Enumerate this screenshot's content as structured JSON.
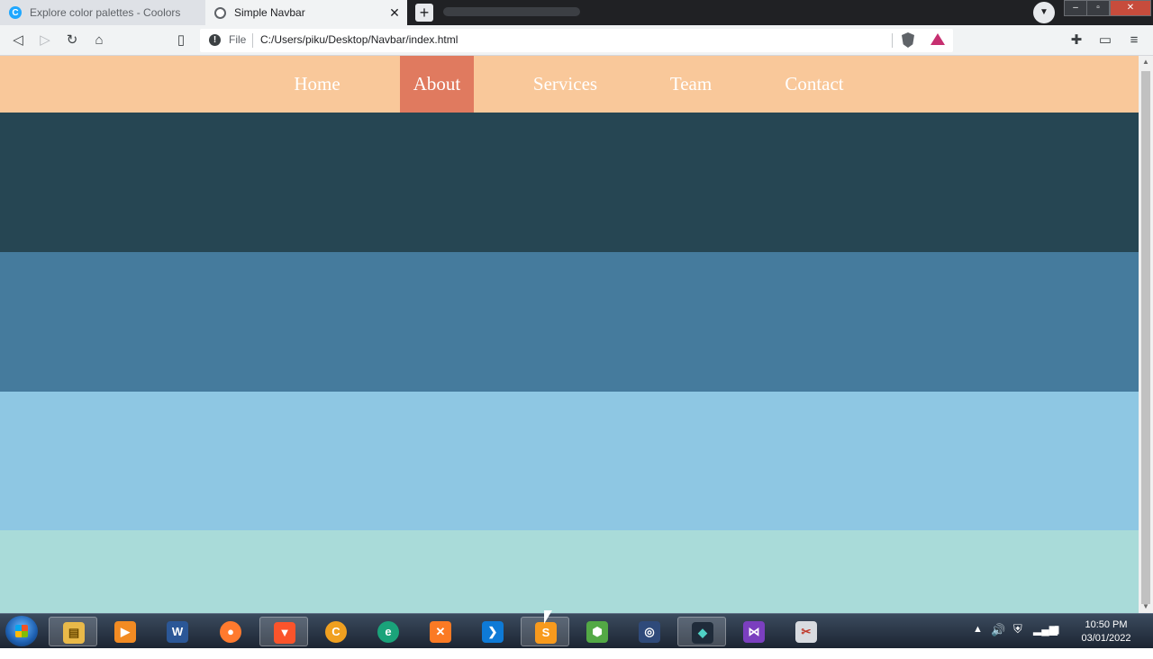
{
  "browser": {
    "tabs": [
      {
        "title": "Explore color palettes - Coolors",
        "active": false,
        "favicon": "coolors-c-icon"
      },
      {
        "title": "Simple Navbar",
        "active": true,
        "favicon": "globe-icon"
      }
    ],
    "close_glyph": "✕",
    "newtab_glyph": "+",
    "address": {
      "scheme_label": "File",
      "url": "C:/Users/piku/Desktop/Navbar/index.html"
    }
  },
  "page": {
    "nav": {
      "items": [
        {
          "label": "Home"
        },
        {
          "label": "About"
        },
        {
          "label": "Services"
        },
        {
          "label": "Team"
        },
        {
          "label": "Contact"
        }
      ],
      "active": "About"
    },
    "colors": {
      "navbar": "#f9c89a",
      "active_item": "#e07a5f",
      "band_1": "#264653",
      "band_2": "#457b9d",
      "band_3": "#8ec7e3",
      "band_4": "#a9dbd9"
    }
  },
  "taskbar": {
    "apps": [
      "windows-start-icon",
      "file-explorer-icon",
      "media-player-icon",
      "word-icon",
      "firefox-icon",
      "brave-icon",
      "ccleaner-icon",
      "edge-icon",
      "xampp-icon",
      "vscode-icon",
      "sublime-text-icon",
      "nodejs-icon",
      "photoshop-icon",
      "filmora-icon",
      "visual-studio-icon",
      "snipping-tool-icon"
    ],
    "time": "10:50 PM",
    "date": "03/01/2022"
  }
}
